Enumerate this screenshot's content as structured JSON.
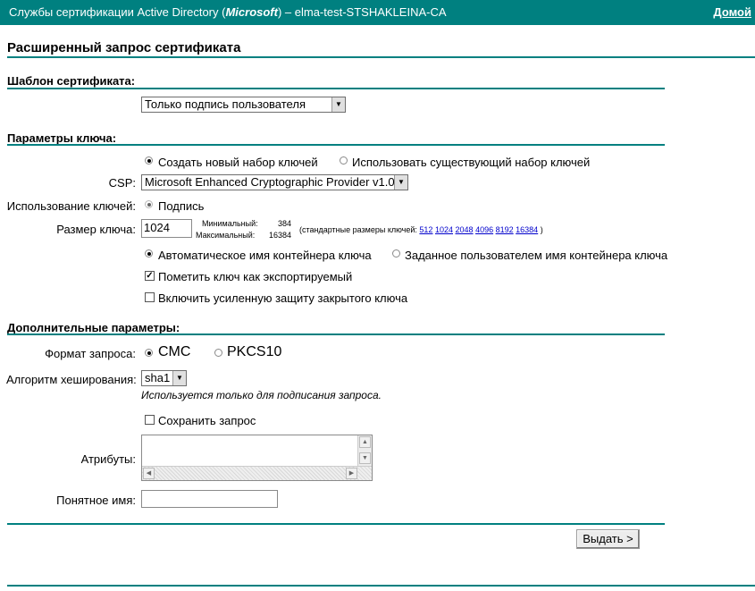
{
  "header": {
    "title_prefix": "Службы сертификации Active Directory (",
    "title_brand": "Microsoft",
    "title_suffix": ")  –  elma-test-STSHAKLEINA-CA",
    "home_link": "Домой"
  },
  "page_title": "Расширенный запрос сертификата",
  "template_section": {
    "heading": "Шаблон сертификата:",
    "selected": "Только подпись пользователя"
  },
  "key_section": {
    "heading": "Параметры ключа:",
    "radio_new": "Создать новый набор ключей",
    "radio_existing": "Использовать существующий набор ключей",
    "csp_label": "CSP:",
    "csp_selected": "Microsoft Enhanced Cryptographic Provider v1.0",
    "key_usage_label": "Использование ключей:",
    "key_usage_value": "Подпись",
    "key_size_label": "Размер ключа:",
    "key_size_value": "1024",
    "min_label": "Минимальный:",
    "min_value": "384",
    "max_label": "Максимальный:",
    "max_value": "16384",
    "std_sizes_prefix": "(стандартные размеры ключей:",
    "std_sizes": [
      "512",
      "1024",
      "2048",
      "4096",
      "8192",
      "16384"
    ],
    "std_sizes_suffix": ")",
    "radio_auto_container": "Автоматическое имя контейнера ключа",
    "radio_user_container": "Заданное пользователем имя контейнера ключа",
    "chk_exportable": "Пометить ключ как экспортируемый",
    "chk_strong_protection": "Включить усиленную защиту закрытого ключа"
  },
  "extra_section": {
    "heading": "Дополнительные параметры:",
    "format_label": "Формат запроса:",
    "format_cmc": "CMC",
    "format_pkcs": "PKCS10",
    "hash_label": "Алгоритм хеширования:",
    "hash_selected": "sha1",
    "hash_note": "Используется только для подписания запроса.",
    "chk_save_request": "Сохранить запрос",
    "attributes_label": "Атрибуты:",
    "friendly_name_label": "Понятное имя:"
  },
  "submit_label": "Выдать >",
  "colors": {
    "accent": "#008080",
    "link": "#0000cc"
  }
}
